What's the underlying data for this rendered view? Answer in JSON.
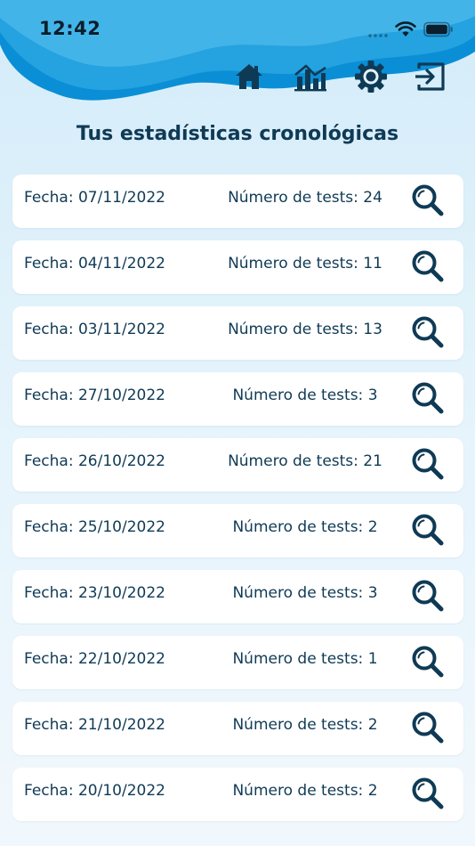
{
  "status_bar": {
    "time": "12:42"
  },
  "colors": {
    "primary": "#0f3a55",
    "wave_dark": "#0a8fd6",
    "wave_light": "#3fb5ea",
    "background": "#dcf0fa",
    "card": "#ffffff"
  },
  "nav": {
    "items": [
      {
        "name": "home",
        "icon": "home-icon"
      },
      {
        "name": "stats",
        "icon": "bar-chart-icon"
      },
      {
        "name": "settings",
        "icon": "gear-icon"
      },
      {
        "name": "logout",
        "icon": "logout-icon"
      }
    ]
  },
  "page": {
    "title": "Tus estadísticas cronológicas"
  },
  "records": [
    {
      "date": "Fecha: 07/11/2022",
      "count": "Número de tests: 24"
    },
    {
      "date": "Fecha: 04/11/2022",
      "count": "Número de tests: 11"
    },
    {
      "date": "Fecha: 03/11/2022",
      "count": "Número de tests: 13"
    },
    {
      "date": "Fecha: 27/10/2022",
      "count": "Número de tests: 3"
    },
    {
      "date": "Fecha: 26/10/2022",
      "count": "Número de tests: 21"
    },
    {
      "date": "Fecha: 25/10/2022",
      "count": "Número de tests: 2"
    },
    {
      "date": "Fecha: 23/10/2022",
      "count": "Número de tests: 3"
    },
    {
      "date": "Fecha: 22/10/2022",
      "count": "Número de tests: 1"
    },
    {
      "date": "Fecha: 21/10/2022",
      "count": "Número de tests: 2"
    },
    {
      "date": "Fecha: 20/10/2022",
      "count": "Número de tests: 2"
    }
  ]
}
